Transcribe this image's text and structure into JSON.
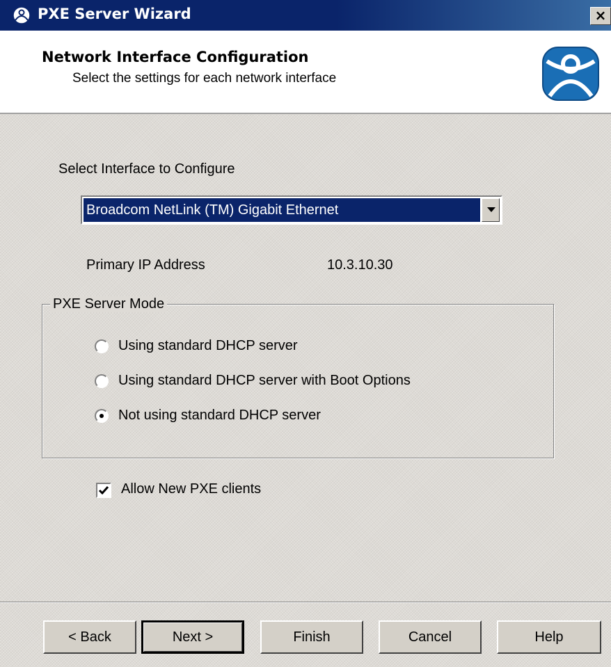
{
  "window": {
    "title": "PXE Server Wizard",
    "close_label": "×"
  },
  "header": {
    "title": "Network Interface Configuration",
    "subtitle": "Select the settings for each network interface"
  },
  "interface": {
    "label": "Select Interface to Configure",
    "selected": "Broadcom NetLink (TM) Gigabit Ethernet"
  },
  "ip": {
    "label": "Primary IP Address",
    "value": "10.3.10.30"
  },
  "mode": {
    "legend": "PXE Server Mode",
    "options": [
      {
        "label": "Using standard DHCP server",
        "selected": false
      },
      {
        "label": "Using standard DHCP server with Boot Options",
        "selected": false
      },
      {
        "label": "Not using standard DHCP server",
        "selected": true
      }
    ]
  },
  "allow_new": {
    "label": "Allow New PXE clients",
    "checked": true
  },
  "buttons": {
    "back": "< Back",
    "next": "Next >",
    "finish": "Finish",
    "cancel": "Cancel",
    "help": "Help"
  },
  "colors": {
    "titlebar": "#0a246a",
    "selection": "#0a246a",
    "logo": "#1a6eb5"
  }
}
